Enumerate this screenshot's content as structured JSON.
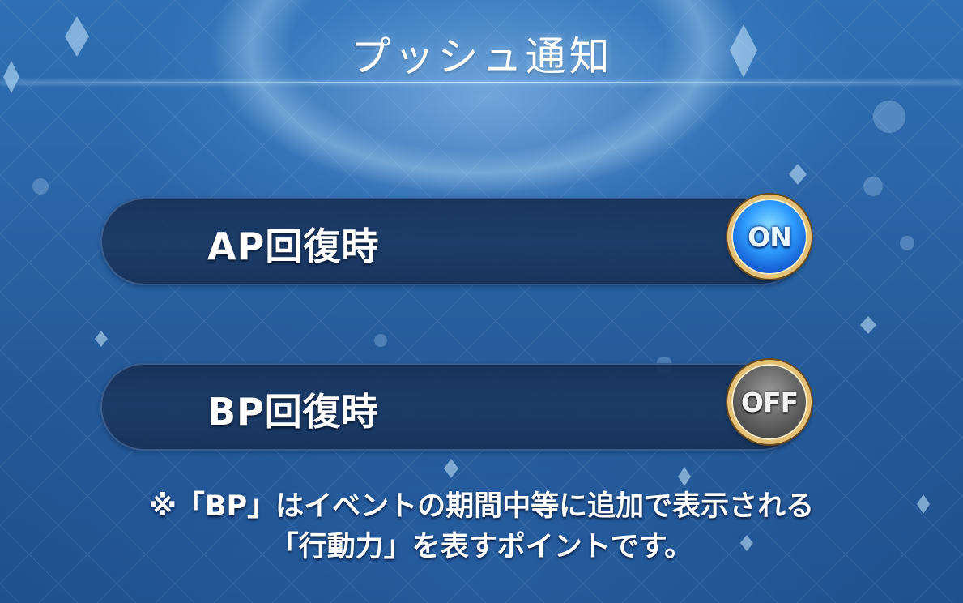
{
  "header": {
    "title": "プッシュ通知"
  },
  "settings": [
    {
      "label": "AP回復時",
      "state": "ON"
    },
    {
      "label": "BP回復時",
      "state": "OFF"
    }
  ],
  "note": {
    "line1": "※「BP」はイベントの期間中等に追加で表示される",
    "line2": "「行動力」を表すポイントです。"
  },
  "colors": {
    "background": "#2a64a6",
    "toggle_on": "#2e9bff",
    "toggle_off": "#6d6d6d",
    "toggle_rim": "#e5bf72"
  }
}
